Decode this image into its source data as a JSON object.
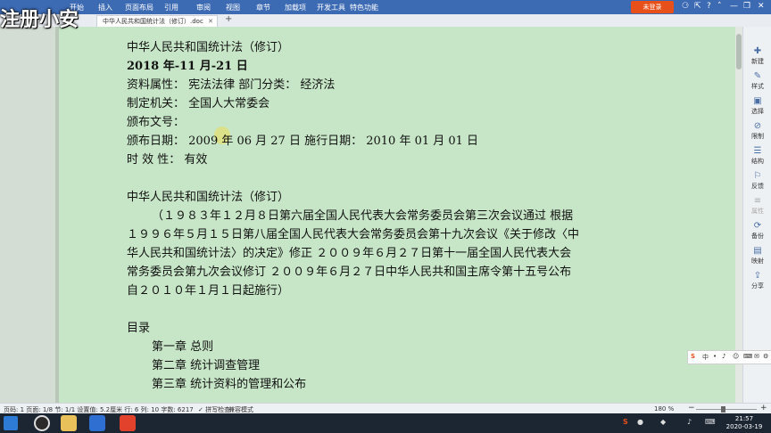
{
  "watermark": "注册小安",
  "menubar": {
    "items": [
      "开始",
      "插入",
      "页面布局",
      "引用",
      "审阅",
      "视图",
      "章节",
      "加载项",
      "开发工具",
      "特色功能"
    ],
    "login_button": "未登录",
    "controls": [
      "⚆",
      "⇱",
      "?",
      "˄",
      "—",
      "❐",
      "✕"
    ]
  },
  "tabbar": {
    "tab_title": "中华人民共和国统计法（修订）.doc",
    "tab_close": "✕",
    "new_tab": "+"
  },
  "document": {
    "lines": [
      "中华人民共和国统计法（修订）",
      "2018 年-11 月-21 日",
      "资料属性：     宪法法律       部门分类：     经济法",
      "制定机关：     全国人大常委会",
      "颁布文号：",
      "颁布日期：     2009 年 06 月 27 日       施行日期：     2010 年 01 月 01 日",
      "时  效  性：     有效",
      "中华人民共和国统计法（修订）",
      "（１９８３年１２月８日第六届全国人民代表大会常务委员会第三次会议通过    根据",
      "１９９６年５月１５日第八届全国人民代表大会常务委员会第十九次会议《关于修改〈中",
      "华人民共和国统计法〉的决定》修正    ２００９年６月２７日第十一届全国人民代表大会",
      "常务委员会第九次会议修订    ２００９年６月２７日中华人民共和国主席令第十五号公布",
      "自２０１０年１月１日起施行）",
      "目录",
      "第一章    总则",
      "第二章    统计调查管理",
      "第三章    统计资料的管理和公布"
    ]
  },
  "sidebar": {
    "items": [
      {
        "icon": "✚",
        "label": "新建"
      },
      {
        "icon": "✎",
        "label": "样式"
      },
      {
        "icon": "▣",
        "label": "选择"
      },
      {
        "icon": "⊘",
        "label": "限制"
      },
      {
        "icon": "☰",
        "label": "结构"
      },
      {
        "icon": "⚐",
        "label": "反馈"
      },
      {
        "icon": "≡",
        "label": "属性"
      },
      {
        "icon": "⟳",
        "label": "备份"
      },
      {
        "icon": "▤",
        "label": "映射"
      },
      {
        "icon": "⇪",
        "label": "分享"
      }
    ]
  },
  "ime": {
    "logo": "S",
    "items": [
      "中",
      "•",
      "♪",
      "☺",
      "⌨",
      "✉",
      "⚙"
    ]
  },
  "statusbar": {
    "page_info": "页码: 1  页面: 1/8  节: 1/1  设置值: 5.2厘米  行: 6  列: 10  字数: 6217",
    "spell_check": "✓ 拼写检查",
    "compat_mode": "兼容模式",
    "zoom": "180 %",
    "zoom_minus": "−",
    "zoom_plus": "+"
  },
  "taskbar": {
    "time": "21:57",
    "date": "2020-03-19",
    "tray": [
      "S",
      "●",
      "◆",
      "♪",
      "⌨"
    ]
  },
  "colors": {
    "page_bg": "#c7e6c7",
    "title_bar": "#3c6ab3",
    "login_button": "#e8501a",
    "taskbar": "#1c2633"
  }
}
